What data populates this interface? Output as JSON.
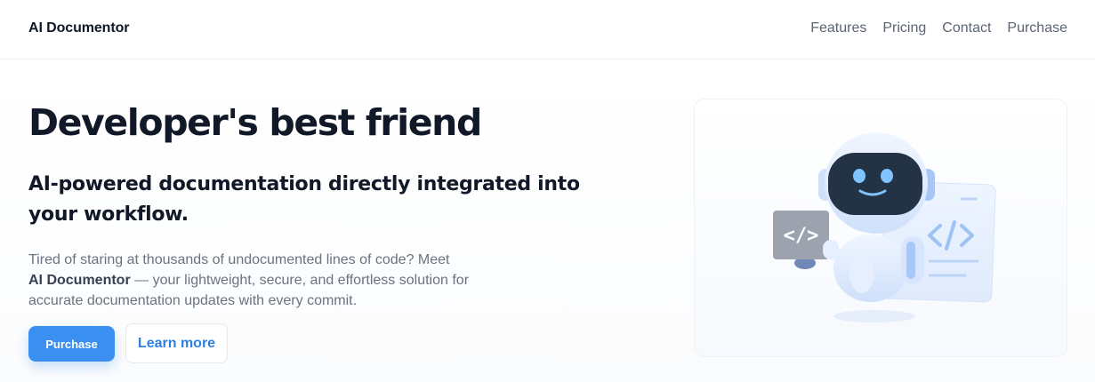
{
  "header": {
    "brand": "AI Documentor",
    "nav": [
      {
        "label": "Features"
      },
      {
        "label": "Pricing"
      },
      {
        "label": "Contact"
      },
      {
        "label": "Purchase"
      }
    ]
  },
  "hero": {
    "title": "Developer's best friend",
    "subtitle": "AI-powered documentation directly integrated into your workflow.",
    "body_prefix": "Tired of staring at thousands of undocumented lines of code? Meet",
    "body_brand": "AI Documentor",
    "body_suffix": " — your lightweight, secure, and effortless solution for accurate documentation updates with every commit.",
    "primary_button": "Purchase",
    "secondary_button": "Learn more"
  },
  "illustration": {
    "subject": "robot-holding-code-card",
    "code_glyph": "</>",
    "colors": {
      "accent": "#3b8ff0",
      "robot_body": "#e6efff",
      "robot_face": "#243246",
      "eyes": "#7fc4ff",
      "code_card": "#9ca3af"
    }
  }
}
